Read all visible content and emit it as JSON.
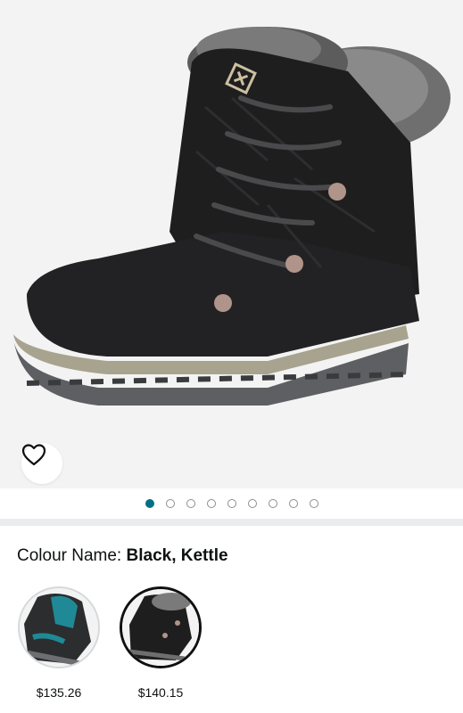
{
  "product": {
    "brand_logo_icon": "columbia-diamond-logo-icon",
    "wishlist_icon": "heart-outline-icon"
  },
  "carousel": {
    "total": 9,
    "active_index": 0
  },
  "colour": {
    "label": "Colour Name:",
    "value": "Black, Kettle"
  },
  "swatches": [
    {
      "price": "$135.26",
      "selected": false,
      "accent": "#1f8a95"
    },
    {
      "price": "$140.15",
      "selected": true,
      "accent": "#2b2b2b"
    }
  ],
  "colors": {
    "accent_dot": "#007185",
    "hero_bg": "#f3f3f3",
    "divider": "#eaeded"
  }
}
